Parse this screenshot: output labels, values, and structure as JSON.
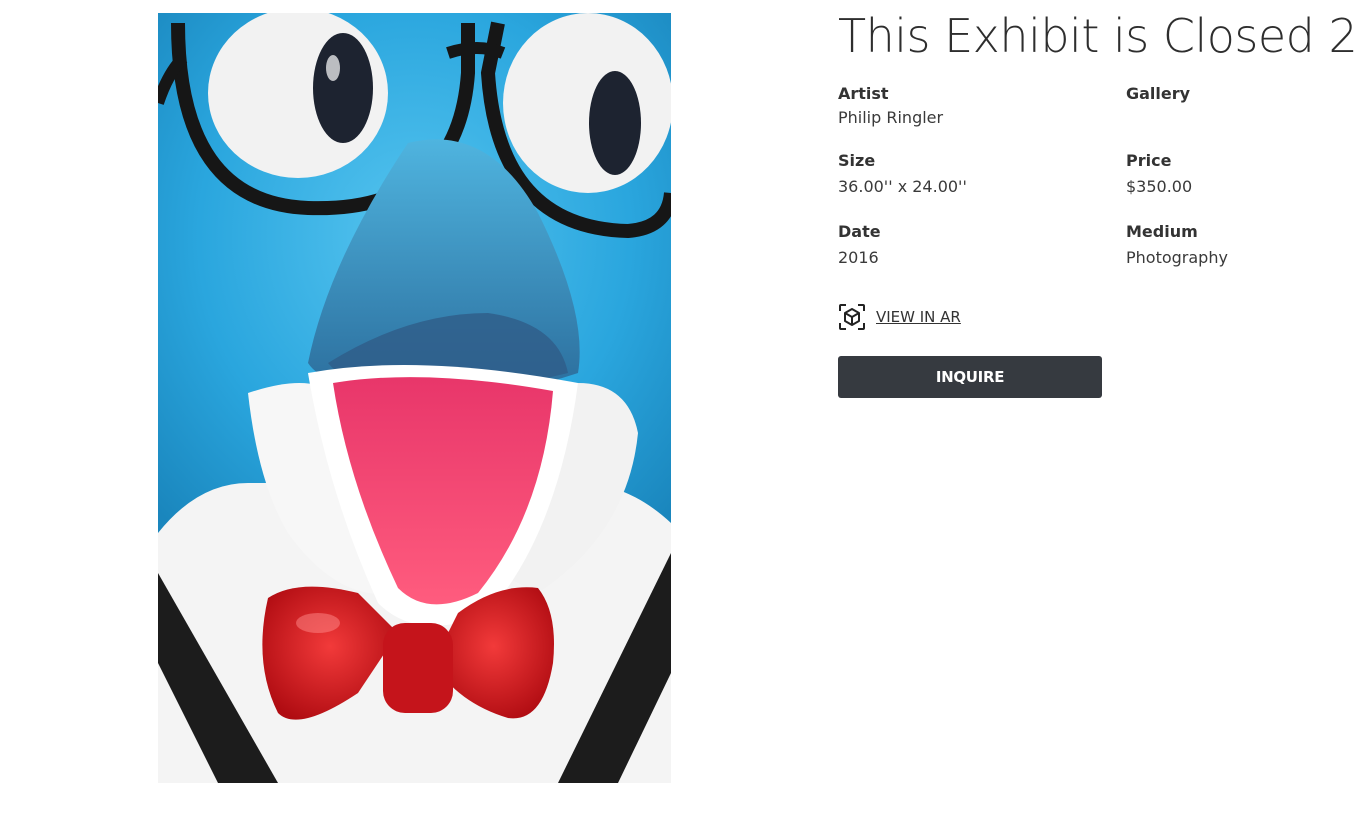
{
  "exhibit": {
    "title": "This Exhibit is Closed 2"
  },
  "artwork": {
    "image_subject": "penguin-sculpture-photo"
  },
  "fields": {
    "artist_label": "Artist",
    "artist_value": "Philip Ringler",
    "gallery_label": "Gallery",
    "gallery_value": "",
    "size_label": "Size",
    "size_value": "36.00'' x 24.00''",
    "price_label": "Price",
    "price_value": "$350.00",
    "date_label": "Date",
    "date_value": "2016",
    "medium_label": "Medium",
    "medium_value": "Photography"
  },
  "actions": {
    "ar_label": "VIEW IN AR",
    "ar_icon": "ar-cube-icon",
    "inquire_label": "INQUIRE"
  },
  "colors": {
    "button_bg": "#363a40",
    "button_text": "#ffffff"
  }
}
